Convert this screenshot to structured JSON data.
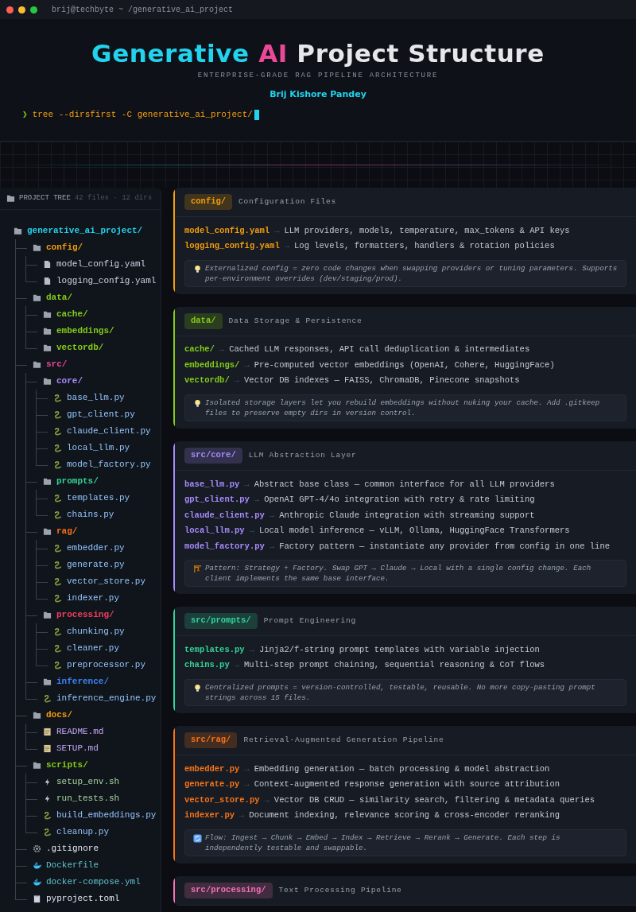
{
  "window": {
    "title": "brij@techbyte ~ /generative_ai_project"
  },
  "header": {
    "title": [
      {
        "text": "Generative",
        "color": "#22d3ee"
      },
      {
        "text": "AI",
        "color": "#ec4899"
      },
      {
        "text": "Project Structure",
        "color": "#e5e7eb"
      }
    ],
    "subtitle": "ENTERPRISE-GRADE RAG PIPELINE ARCHITECTURE",
    "author": "Brij Kishore Pandey",
    "prompt": "❯",
    "command": "tree --dirsfirst -C generative_ai_project/"
  },
  "sidebar": {
    "title": "PROJECT TREE",
    "stats": "42 files · 12 dirs",
    "tree": {
      "name": "generative_ai_project/",
      "kind": "dir",
      "color": "#22d3ee",
      "children": [
        {
          "name": "config/",
          "kind": "dir",
          "color": "#f59e0b",
          "children": [
            {
              "name": "model_config.yaml",
              "kind": "yaml"
            },
            {
              "name": "logging_config.yaml",
              "kind": "yaml"
            }
          ]
        },
        {
          "name": "data/",
          "kind": "dir",
          "color": "#84cc16",
          "children": [
            {
              "name": "cache/",
              "kind": "dir",
              "color": "#84cc16"
            },
            {
              "name": "embeddings/",
              "kind": "dir",
              "color": "#84cc16"
            },
            {
              "name": "vectordb/",
              "kind": "dir",
              "color": "#84cc16"
            }
          ]
        },
        {
          "name": "src/",
          "kind": "dir",
          "color": "#ec4899",
          "children": [
            {
              "name": "core/",
              "kind": "dir",
              "color": "#a78bfa",
              "children": [
                {
                  "name": "base_llm.py",
                  "kind": "py"
                },
                {
                  "name": "gpt_client.py",
                  "kind": "py"
                },
                {
                  "name": "claude_client.py",
                  "kind": "py"
                },
                {
                  "name": "local_llm.py",
                  "kind": "py"
                },
                {
                  "name": "model_factory.py",
                  "kind": "py"
                }
              ]
            },
            {
              "name": "prompts/",
              "kind": "dir",
              "color": "#34d399",
              "children": [
                {
                  "name": "templates.py",
                  "kind": "py"
                },
                {
                  "name": "chains.py",
                  "kind": "py"
                }
              ]
            },
            {
              "name": "rag/",
              "kind": "dir",
              "color": "#f97316",
              "children": [
                {
                  "name": "embedder.py",
                  "kind": "py"
                },
                {
                  "name": "generate.py",
                  "kind": "py"
                },
                {
                  "name": "vector_store.py",
                  "kind": "py"
                },
                {
                  "name": "indexer.py",
                  "kind": "py"
                }
              ]
            },
            {
              "name": "processing/",
              "kind": "dir",
              "color": "#f43f5e",
              "children": [
                {
                  "name": "chunking.py",
                  "kind": "py"
                },
                {
                  "name": "cleaner.py",
                  "kind": "py"
                },
                {
                  "name": "preprocessor.py",
                  "kind": "py"
                }
              ]
            },
            {
              "name": "inference/",
              "kind": "dir",
              "color": "#3b82f6"
            },
            {
              "name": "inference_engine.py",
              "kind": "py"
            }
          ]
        },
        {
          "name": "docs/",
          "kind": "dir",
          "color": "#f59e0b",
          "children": [
            {
              "name": "README.md",
              "kind": "md"
            },
            {
              "name": "SETUP.md",
              "kind": "md"
            }
          ]
        },
        {
          "name": "scripts/",
          "kind": "dir",
          "color": "#84cc16",
          "children": [
            {
              "name": "setup_env.sh",
              "kind": "sh"
            },
            {
              "name": "run_tests.sh",
              "kind": "sh"
            },
            {
              "name": "build_embeddings.py",
              "kind": "py"
            },
            {
              "name": "cleanup.py",
              "kind": "py"
            }
          ]
        },
        {
          "name": ".gitignore",
          "kind": "gitignore"
        },
        {
          "name": "Dockerfile",
          "kind": "docker"
        },
        {
          "name": "docker-compose.yml",
          "kind": "docker"
        },
        {
          "name": "pyproject.toml",
          "kind": "toml"
        }
      ]
    }
  },
  "cards": [
    {
      "tag": "config/",
      "title": "Configuration Files",
      "color": "#f59e0b",
      "items": [
        {
          "name": "model_config.yaml",
          "arrow": "→",
          "desc": "LLM providers, models, temperature, max_tokens & API keys"
        },
        {
          "name": "logging_config.yaml",
          "arrow": "→",
          "desc": "Log levels, formatters, handlers & rotation policies"
        }
      ],
      "note": {
        "kind": "tip",
        "text": "Externalized config = zero code changes when swapping providers or tuning parameters. Supports per-environment overrides (dev/staging/prod)."
      }
    },
    {
      "tag": "data/",
      "title": "Data Storage & Persistence",
      "color": "#84cc16",
      "items": [
        {
          "name": "cache/",
          "arrow": "→",
          "desc": "Cached LLM responses, API call deduplication & intermediates"
        },
        {
          "name": "embeddings/",
          "arrow": "→",
          "desc": "Pre-computed vector embeddings (OpenAI, Cohere, HuggingFace)"
        },
        {
          "name": "vectordb/",
          "arrow": "→",
          "desc": "Vector DB indexes — FAISS, ChromaDB, Pinecone snapshots"
        }
      ],
      "note": {
        "kind": "tip",
        "text": "Isolated storage layers let you rebuild embeddings without nuking your cache. Add .gitkeep files to preserve empty dirs in version control."
      }
    },
    {
      "tag": "src/core/",
      "title": "LLM Abstraction Layer",
      "color": "#a78bfa",
      "items": [
        {
          "name": "base_llm.py",
          "arrow": "→",
          "desc": "Abstract base class — common interface for all LLM providers"
        },
        {
          "name": "gpt_client.py",
          "arrow": "→",
          "desc": "OpenAI GPT-4/4o integration with retry & rate limiting"
        },
        {
          "name": "claude_client.py",
          "arrow": "→",
          "desc": "Anthropic Claude integration with streaming support"
        },
        {
          "name": "local_llm.py",
          "arrow": "→",
          "desc": "Local model inference — vLLM, Ollama, HuggingFace Transformers"
        },
        {
          "name": "model_factory.py",
          "arrow": "→",
          "desc": "Factory pattern — instantiate any provider from config in one line"
        }
      ],
      "note": {
        "kind": "pattern",
        "text": "Pattern: Strategy + Factory. Swap GPT → Claude → Local with a single config change. Each client implements the same base interface."
      }
    },
    {
      "tag": "src/prompts/",
      "title": "Prompt Engineering",
      "color": "#34d399",
      "items": [
        {
          "name": "templates.py",
          "arrow": "→",
          "desc": "Jinja2/f-string prompt templates with variable injection"
        },
        {
          "name": "chains.py",
          "arrow": "→",
          "desc": "Multi-step prompt chaining, sequential reasoning & CoT flows"
        }
      ],
      "note": {
        "kind": "tip",
        "text": "Centralized prompts = version-controlled, testable, reusable. No more copy-pasting prompt strings across 15 files."
      }
    },
    {
      "tag": "src/rag/",
      "title": "Retrieval-Augmented Generation Pipeline",
      "color": "#f97316",
      "items": [
        {
          "name": "embedder.py",
          "arrow": "→",
          "desc": "Embedding generation — batch processing & model abstraction"
        },
        {
          "name": "generate.py",
          "arrow": "→",
          "desc": "Context-augmented response generation with source attribution"
        },
        {
          "name": "vector_store.py",
          "arrow": "→",
          "desc": "Vector DB CRUD — similarity search, filtering & metadata queries"
        },
        {
          "name": "indexer.py",
          "arrow": "→",
          "desc": "Document indexing, relevance scoring & cross-encoder reranking"
        }
      ],
      "note": {
        "kind": "flow",
        "text": "Flow: Ingest → Chunk → Embed → Index → Retrieve → Rerank → Generate. Each step is independently testable and swappable."
      }
    },
    {
      "tag": "src/processing/",
      "title": "Text Processing Pipeline",
      "color": "#f472b6"
    }
  ]
}
